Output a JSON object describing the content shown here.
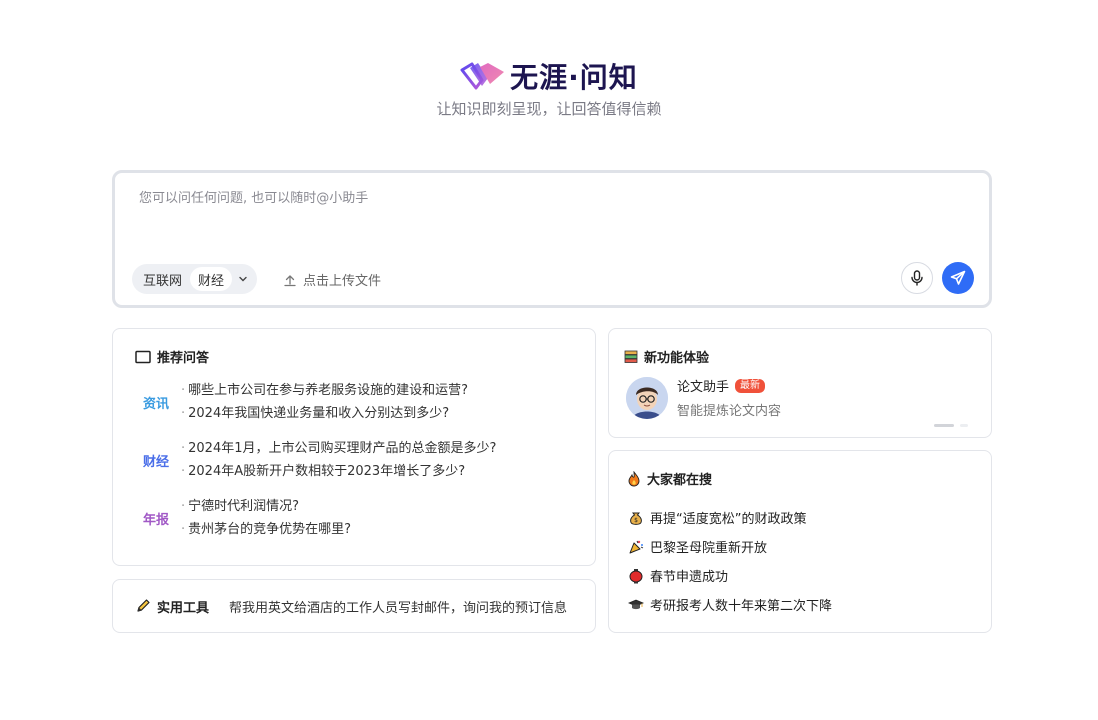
{
  "brand": {
    "name": "无涯·问知",
    "tagline": "让知识即刻呈现，让回答值得信赖"
  },
  "search": {
    "placeholder": "您可以问任何问题, 也可以随时@小助手",
    "value": "",
    "chips": [
      "互联网",
      "财经"
    ],
    "upload_label": "点击上传文件"
  },
  "recommend": {
    "title": "推荐问答",
    "groups": [
      {
        "tag": "资讯",
        "color": "#3a9be0",
        "items": [
          "哪些上市公司在参与养老服务设施的建设和运营?",
          "2024年我国快递业务量和收入分别达到多少?"
        ]
      },
      {
        "tag": "财经",
        "color": "#4a6ee8",
        "items": [
          "2024年1月，上市公司购买理财产品的总金额是多少?",
          "2024年A股新开户数相较于2023年增长了多少?"
        ]
      },
      {
        "tag": "年报",
        "color": "#a159c6",
        "items": [
          "宁德时代利润情况?",
          "贵州茅台的竞争优势在哪里?"
        ]
      }
    ]
  },
  "tools": {
    "title": "实用工具",
    "example": "帮我用英文给酒店的工作人员写封邮件，询问我的预订信息"
  },
  "features": {
    "title": "新功能体验",
    "name": "论文助手",
    "badge": "最新",
    "desc": "智能提炼论文内容"
  },
  "hot": {
    "title": "大家都在搜",
    "items": [
      {
        "icon": "money-bag-icon",
        "text": "再提“适度宽松”的财政政策"
      },
      {
        "icon": "party-popper-icon",
        "text": "巴黎圣母院重新开放"
      },
      {
        "icon": "red-lantern-icon",
        "text": "春节申遗成功"
      },
      {
        "icon": "graduation-cap-icon",
        "text": "考研报考人数十年来第二次下降"
      }
    ]
  },
  "colors": {
    "accent": "#2f6cf6",
    "brand_text": "#1d1550",
    "badge": "#f0513a"
  }
}
